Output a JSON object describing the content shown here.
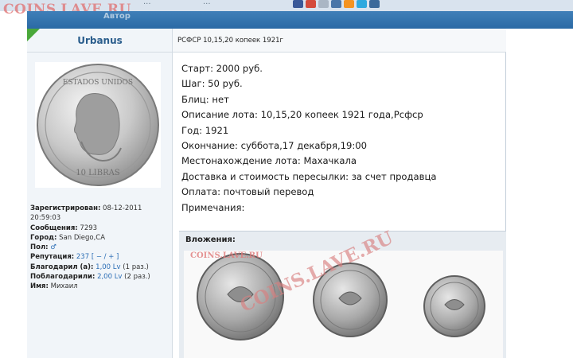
{
  "top": {
    "watermark": "COINS.LAVE.RU",
    "fragment_text": "...",
    "fragment_text_2": "...",
    "header_label": "Автор",
    "share_icons": [
      "facebook-icon",
      "google-icon",
      "mail-icon",
      "vk-icon",
      "odnoklassniki-icon",
      "twitter-icon",
      "livejournal-icon"
    ],
    "share_colors": [
      "#3b5998",
      "#d44b3c",
      "#aab6c4",
      "#4a76a8",
      "#f39321",
      "#2ea9df",
      "#3c6a9b"
    ]
  },
  "user": {
    "name": "Urbanus",
    "avatar_desc": "silver coin portrait",
    "fields": [
      {
        "label": "Зарегистрирован:",
        "value": "08-12-2011 20:59:03"
      },
      {
        "label": "Сообщения:",
        "value": "7293"
      },
      {
        "label": "Город:",
        "value": "San Diego,CA"
      },
      {
        "label": "Пол:",
        "value": ""
      },
      {
        "label": "Репутация:",
        "value": "237"
      },
      {
        "label": "Благодарил (а):",
        "value": "1,00 Lv",
        "suffix": "(1 раз.)"
      },
      {
        "label": "Поблагодарили:",
        "value": "2,00 Lv",
        "suffix": "(2 раз.)"
      },
      {
        "label": "Имя:",
        "value": "Михаил"
      }
    ],
    "reputation_controls": "[ − / + ]"
  },
  "post": {
    "title": "РСФСР 10,15,20 копеек 1921г",
    "lines": [
      "Старт: 2000 руб.",
      "Шаг: 50 руб.",
      "Блиц: нет",
      "Описание лота: 10,15,20 копеек 1921 года,Рсфср",
      "Год: 1921",
      "Окончание: суббота,17 декабря,19:00",
      "Местонахождение лота: Махачкала",
      "Доставка и стоимость пересылки: за счет продавца",
      "Оплата: почтовый перевод",
      "Примечания:"
    ]
  },
  "attachments": {
    "heading": "Вложения:",
    "watermark_small": "COINS.LAVE.RU",
    "watermark_large": "COINS.LAVE.RU"
  },
  "colors": {
    "accent_blue": "#2b6aa5",
    "username": "#2a5d8c",
    "link": "#2a6db5",
    "watermark": "#e07070",
    "corner_marker": "#4aa83a"
  }
}
